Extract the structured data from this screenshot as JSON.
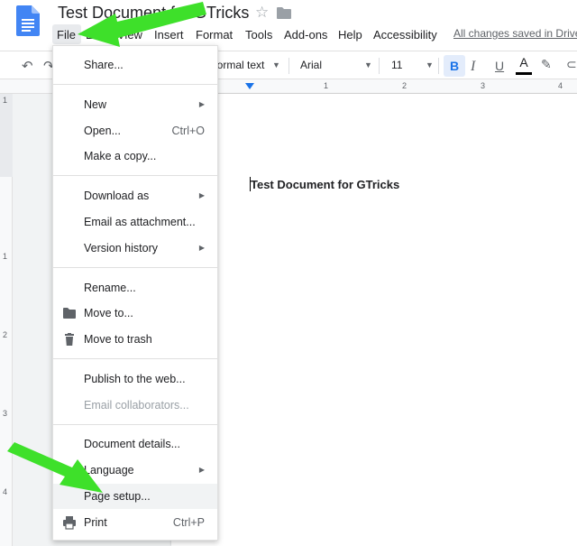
{
  "header": {
    "title": "Test Document for GTricks",
    "save_status": "All changes saved in Drive"
  },
  "menubar": {
    "items": [
      "File",
      "Edit",
      "View",
      "Insert",
      "Format",
      "Tools",
      "Add-ons",
      "Help",
      "Accessibility"
    ]
  },
  "toolbar": {
    "style": "Normal text",
    "font": "Arial",
    "size": "11",
    "bold": "B",
    "italic": "I",
    "underline": "U",
    "text_color": "A"
  },
  "ruler": {
    "h_marks": [
      "1",
      "2",
      "3",
      "4"
    ],
    "v_marks": [
      "1",
      "1",
      "2",
      "3",
      "4"
    ]
  },
  "document": {
    "body_text": "Test Document for GTricks"
  },
  "file_menu": {
    "items": [
      {
        "label": "Share..."
      },
      {
        "label": "New"
      },
      {
        "label": "Open...",
        "shortcut": "Ctrl+O"
      },
      {
        "label": "Make a copy..."
      },
      {
        "label": "Download as"
      },
      {
        "label": "Email as attachment..."
      },
      {
        "label": "Version history"
      },
      {
        "label": "Rename..."
      },
      {
        "label": "Move to..."
      },
      {
        "label": "Move to trash"
      },
      {
        "label": "Publish to the web..."
      },
      {
        "label": "Email collaborators..."
      },
      {
        "label": "Document details..."
      },
      {
        "label": "Language"
      },
      {
        "label": "Page setup..."
      },
      {
        "label": "Print",
        "shortcut": "Ctrl+P"
      }
    ]
  },
  "colors": {
    "annotation_arrow": "#3ee02a",
    "accent": "#1a73e8"
  }
}
